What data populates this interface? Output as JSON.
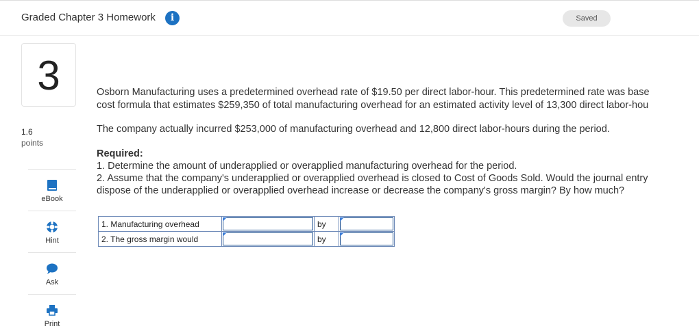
{
  "header": {
    "title": "Graded Chapter 3 Homework",
    "info_icon": "info-icon",
    "saved_label": "Saved"
  },
  "sidebar": {
    "question_number": "3",
    "points_value": "1.6",
    "points_label": "points",
    "buttons": [
      {
        "label": "eBook",
        "icon": "book-icon"
      },
      {
        "label": "Hint",
        "icon": "lifebuoy-icon"
      },
      {
        "label": "Ask",
        "icon": "speech-bubble-icon"
      },
      {
        "label": "Print",
        "icon": "printer-icon"
      }
    ]
  },
  "question": {
    "paragraph1_line1": "Osborn Manufacturing uses a predetermined overhead rate of $19.50 per direct labor-hour. This predetermined rate was base",
    "paragraph1_line2": "cost formula that estimates $259,350 of total manufacturing overhead for an estimated activity level of 13,300 direct labor-hou",
    "paragraph2": "The company actually incurred $253,000 of manufacturing overhead and 12,800 direct labor-hours during the period.",
    "required_label": "Required:",
    "req1": "1. Determine the amount of underapplied or overapplied manufacturing overhead for the period.",
    "req2_line1": "2. Assume that the company's underapplied or overapplied overhead is closed to Cost of Goods Sold. Would the journal entry",
    "req2_line2": "dispose of the underapplied or overapplied overhead increase or decrease the company's gross margin? By how much?"
  },
  "answer_table": {
    "rows": [
      {
        "label": "1. Manufacturing overhead",
        "by": "by",
        "select_value": "",
        "amount_value": ""
      },
      {
        "label": "2. The gross margin would",
        "by": "by",
        "select_value": "",
        "amount_value": ""
      }
    ]
  },
  "colors": {
    "accent": "#1d72c2",
    "field_border": "#1b4e8f",
    "table_border": "#6e8ab8"
  }
}
